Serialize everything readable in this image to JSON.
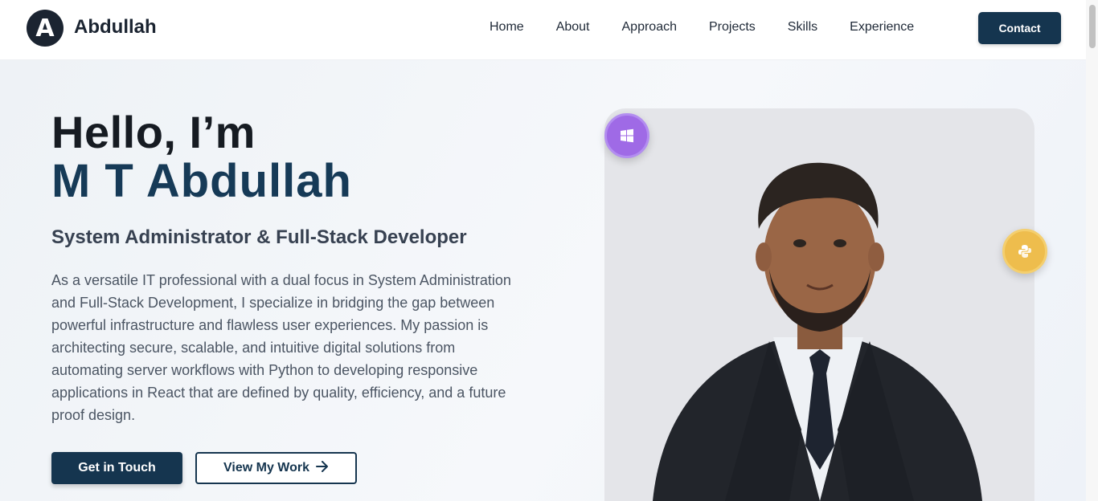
{
  "brand": {
    "logo_letter": "A",
    "name": "Abdullah"
  },
  "nav": {
    "items": [
      "Home",
      "About",
      "Approach",
      "Projects",
      "Skills",
      "Experience"
    ],
    "contact_label": "Contact"
  },
  "hero": {
    "greeting": "Hello, I’m",
    "name": "M T Abdullah",
    "role": "System Administrator & Full-Stack Developer",
    "bio": "As a versatile IT professional with a dual focus in System Administration and Full-Stack Development, I specialize in bridging the gap between powerful infrastructure and flawless user experiences. My passion is architecting secure, scalable, and intuitive digital solutions from automating server workflows with Python to developing responsive applications in React that are defined by quality, efficiency, and a future proof design.",
    "primary_button": "Get in Touch",
    "secondary_button": "View My Work"
  },
  "badges": {
    "windows_icon": "windows-icon",
    "python_icon": "python-icon"
  },
  "colors": {
    "primary": "#15354f",
    "name_accent": "#163a57",
    "windows_badge": "#9f6ae6",
    "python_badge": "#eebd4d"
  }
}
